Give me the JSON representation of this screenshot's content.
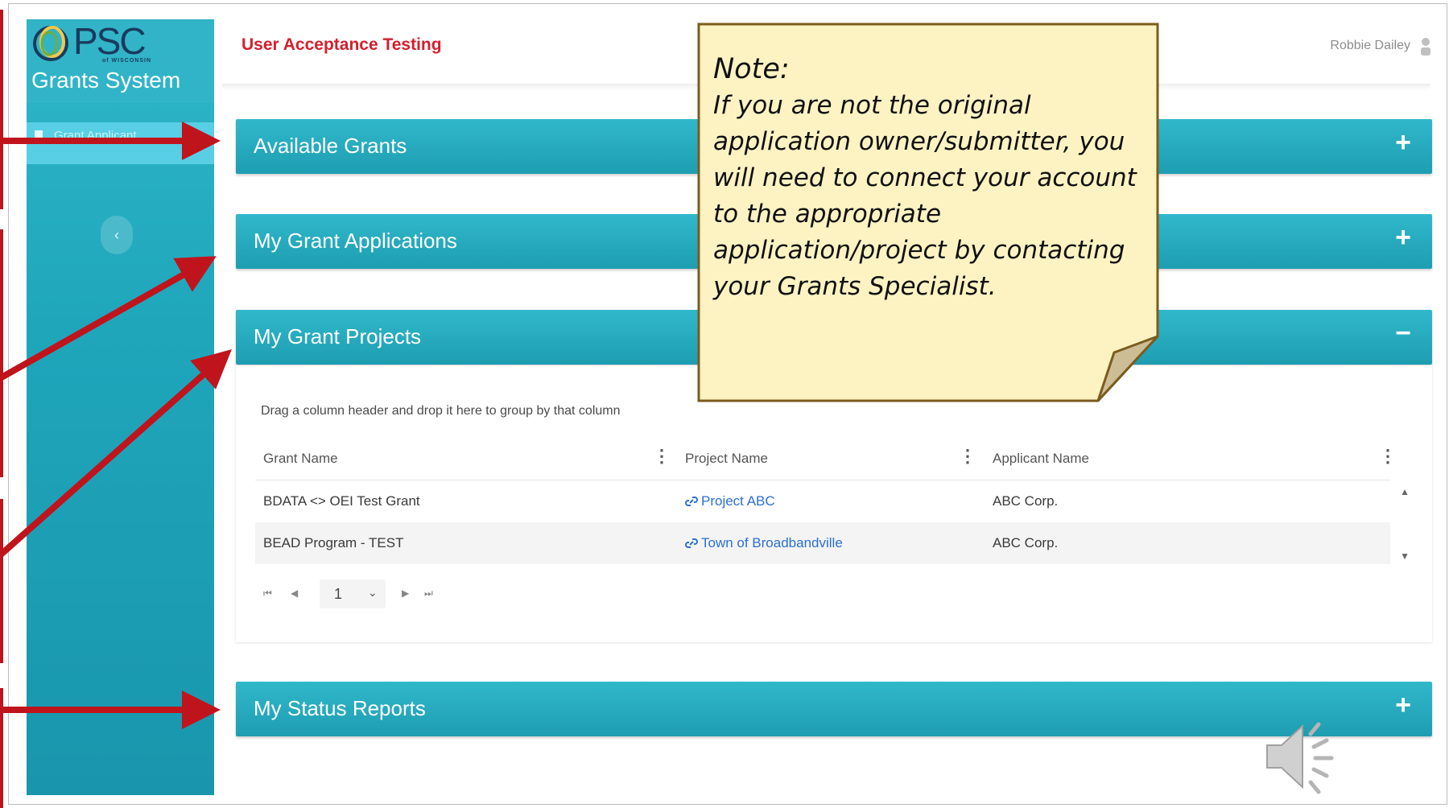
{
  "app": {
    "logo_text": "PSC",
    "logo_sub": "of WISCONSIN",
    "system_name": "Grants System"
  },
  "sidebar": {
    "items": [
      {
        "label": "Grant Applicant",
        "icon": "document-icon"
      }
    ],
    "collapse_icon": "chevron-left-icon"
  },
  "header": {
    "environment": "User Acceptance Testing",
    "user_name": "Robbie Dailey",
    "user_icon": "user-icon"
  },
  "panels": {
    "available_grants": {
      "title": "Available Grants",
      "toggle": "+"
    },
    "my_grant_applications": {
      "title": "My Grant Applications",
      "toggle": "+"
    },
    "my_grant_projects": {
      "title": "My Grant Projects",
      "toggle": "−"
    },
    "my_status_reports": {
      "title": "My Status Reports",
      "toggle": "+"
    }
  },
  "projects_grid": {
    "group_hint": "Drag a column header and drop it here to group by that column",
    "columns": [
      "Grant Name",
      "Project Name",
      "Applicant Name"
    ],
    "rows": [
      {
        "grant_name": "BDATA <> OEI Test Grant",
        "project_name": "Project ABC",
        "applicant_name": "ABC Corp."
      },
      {
        "grant_name": "BEAD Program - TEST",
        "project_name": "Town of Broadbandville",
        "applicant_name": "ABC Corp."
      }
    ],
    "pager": {
      "current_page": "1"
    }
  },
  "note": {
    "title": "Note:",
    "body": "If you are not the original application owner/submitter, you will need to connect your account to the appropriate application/project by contacting your Grants Specialist.",
    "fill_color": "#fdf3c2",
    "border_color": "#7a5c1e"
  },
  "annotation": {
    "arrow_color": "#c0141c",
    "speaker_icon": "speaker-icon"
  }
}
